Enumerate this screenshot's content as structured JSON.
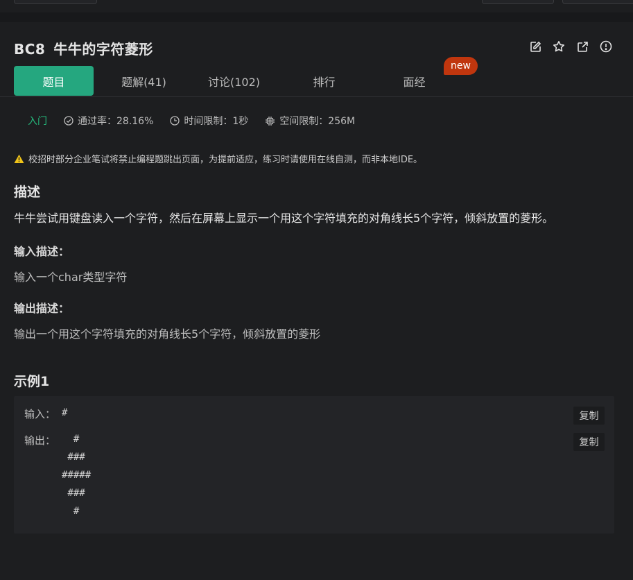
{
  "problem": {
    "id": "BC8",
    "title": "牛牛的字符菱形"
  },
  "actions": {
    "icons": [
      "edit-icon",
      "star-icon",
      "external-link-icon",
      "report-icon"
    ]
  },
  "tabs": [
    {
      "label": "题目",
      "active": true
    },
    {
      "label": "题解(41)"
    },
    {
      "label": "讨论(102)"
    },
    {
      "label": "排行"
    },
    {
      "label": "面经"
    }
  ],
  "badge": {
    "label": "new",
    "color": "#c0360e"
  },
  "meta": {
    "level": "入门",
    "pass_rate": "通过率：28.16%",
    "time_limit": "时间限制：1秒",
    "space_limit": "空间限制：256M"
  },
  "notice": "校招时部分企业笔试将禁止编程题跳出页面，为提前适应，练习时请使用在线自测，而非本地IDE。",
  "description": {
    "heading": "描述",
    "text": "牛牛尝试用键盘读入一个字符，然后在屏幕上显示一个用这个字符填充的对角线长5个字符，倾斜放置的菱形。"
  },
  "input_desc": {
    "heading": "输入描述：",
    "text": "输入一个char类型字符"
  },
  "output_desc": {
    "heading": "输出描述：",
    "text": "输出一个用这个字符填充的对角线长5个字符，倾斜放置的菱形"
  },
  "example": {
    "heading": "示例1",
    "input_label": "输入：",
    "input_value": "#",
    "output_label": "输出：",
    "output_value": "  #\n ###\n#####\n ###\n  #",
    "copy_label": "复制"
  },
  "colors": {
    "accent": "#25a77f",
    "level_green": "#25bb7d",
    "badge": "#c0360e",
    "warning": "#f0c419"
  }
}
